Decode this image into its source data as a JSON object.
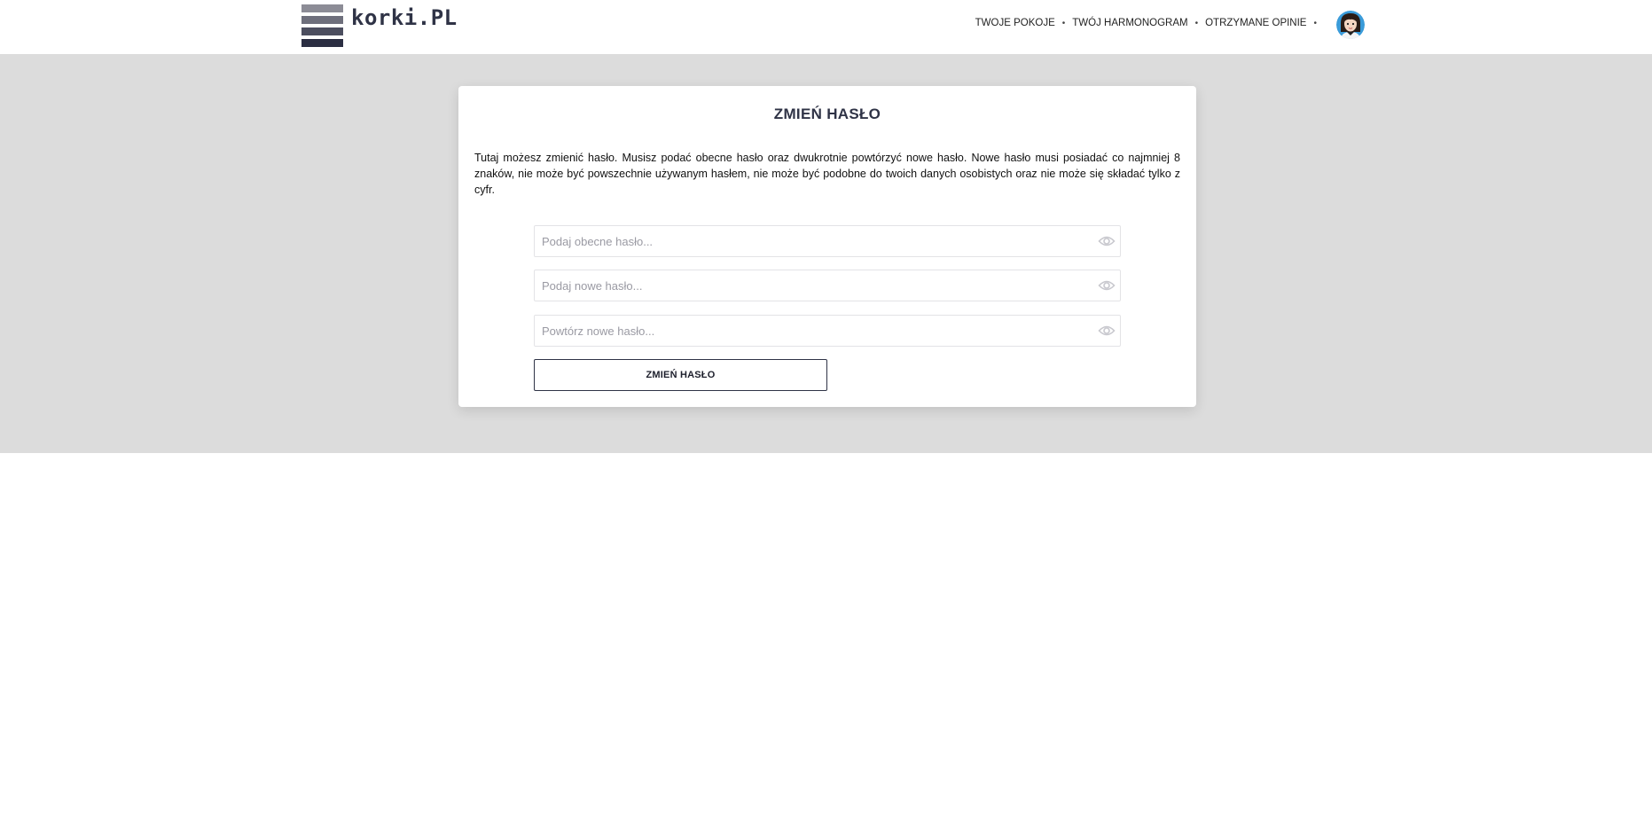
{
  "header": {
    "logo_text": "korki.PL",
    "nav": [
      {
        "label": "TWOJE POKOJE"
      },
      {
        "label": "TWÓJ HARMONOGRAM"
      },
      {
        "label": "OTRZYMANE OPINIE"
      }
    ],
    "separator": "•",
    "avatar_icon": "user-avatar-icon"
  },
  "card": {
    "title": "ZMIEŃ HASŁO",
    "description": "Tutaj możesz zmienić hasło. Musisz podać obecne hasło oraz dwukrotnie powtórzyć nowe hasło. Nowe hasło musi posiadać co najmniej 8 znaków, nie może być powszechnie używanym hasłem, nie może być podobne do twoich danych osobistych oraz nie może się składać tylko z cyfr.",
    "fields": [
      {
        "value": "",
        "placeholder": "Podaj obecne hasło..."
      },
      {
        "value": "",
        "placeholder": "Podaj nowe hasło..."
      },
      {
        "value": "",
        "placeholder": "Powtórz nowe hasło..."
      }
    ],
    "toggle_icon": "eye-icon",
    "submit_label": "ZMIEŃ HASŁO"
  },
  "colors": {
    "band_background": "#dcdcdc",
    "brand_dark": "#2f3346",
    "placeholder": "#9a9aa3",
    "eye_icon": "#c8c8ce"
  }
}
